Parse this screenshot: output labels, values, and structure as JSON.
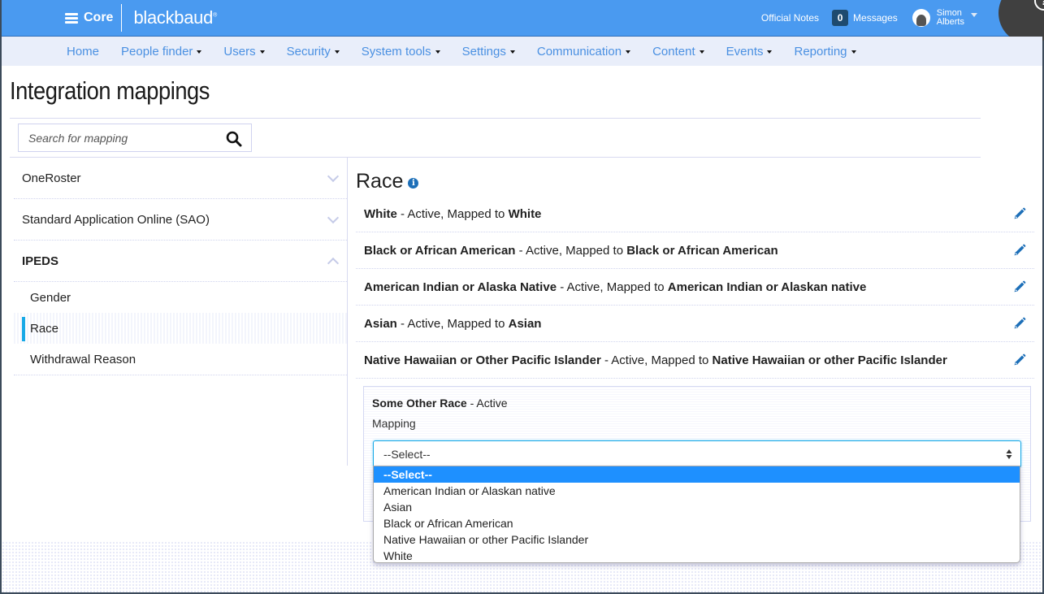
{
  "topbar": {
    "app_name": "Core",
    "brand": "blackbaud",
    "official_notes": "Official Notes",
    "messages_count": "0",
    "messages_label": "Messages",
    "user_first": "Simon",
    "user_last": "Alberts",
    "help": "?"
  },
  "nav": {
    "items": [
      {
        "label": "Home",
        "dropdown": false
      },
      {
        "label": "People finder",
        "dropdown": true
      },
      {
        "label": "Users",
        "dropdown": true
      },
      {
        "label": "Security",
        "dropdown": true
      },
      {
        "label": "System tools",
        "dropdown": true
      },
      {
        "label": "Settings",
        "dropdown": true
      },
      {
        "label": "Communication",
        "dropdown": true
      },
      {
        "label": "Content",
        "dropdown": true
      },
      {
        "label": "Events",
        "dropdown": true
      },
      {
        "label": "Reporting",
        "dropdown": true
      }
    ]
  },
  "page": {
    "title": "Integration mappings",
    "search_placeholder": "Search for mapping"
  },
  "sidebar": {
    "groups": [
      {
        "label": "OneRoster",
        "expanded": false
      },
      {
        "label": "Standard Application Online (SAO)",
        "expanded": false
      },
      {
        "label": "IPEDS",
        "expanded": true
      }
    ],
    "ipeds_items": [
      {
        "label": "Gender",
        "active": false
      },
      {
        "label": "Race",
        "active": true
      },
      {
        "label": "Withdrawal Reason",
        "active": false
      }
    ]
  },
  "main": {
    "section_title": "Race",
    "mappings": [
      {
        "name": "White",
        "status": " - Active, Mapped to ",
        "mapped_to": "White"
      },
      {
        "name": "Black or African American",
        "status": " - Active, Mapped to ",
        "mapped_to": "Black or African American"
      },
      {
        "name": "American Indian or Alaska Native",
        "status": " - Active, Mapped to ",
        "mapped_to": "American Indian or Alaskan native"
      },
      {
        "name": "Asian",
        "status": " - Active, Mapped to ",
        "mapped_to": "Asian"
      },
      {
        "name": "Native Hawaiian or Other Pacific Islander",
        "status": " - Active, Mapped to ",
        "mapped_to": "Native Hawaiian or other Pacific Islander"
      }
    ],
    "edit": {
      "name": "Some Other Race",
      "status": " - Active",
      "mapping_label": "Mapping",
      "selected_value": "--Select--",
      "options": [
        "--Select--",
        "American Indian or Alaskan native",
        "Asian",
        "Black or African American",
        "Native Hawaiian or other Pacific Islander",
        "White"
      ]
    }
  },
  "colors": {
    "topbar": "#4a9af0",
    "nav_bg": "#e9eefa",
    "nav_link": "#4a90e2",
    "active_marker": "#17a9e6",
    "selected_option": "#1e90ff",
    "icon_blue": "#1d6fb8"
  }
}
